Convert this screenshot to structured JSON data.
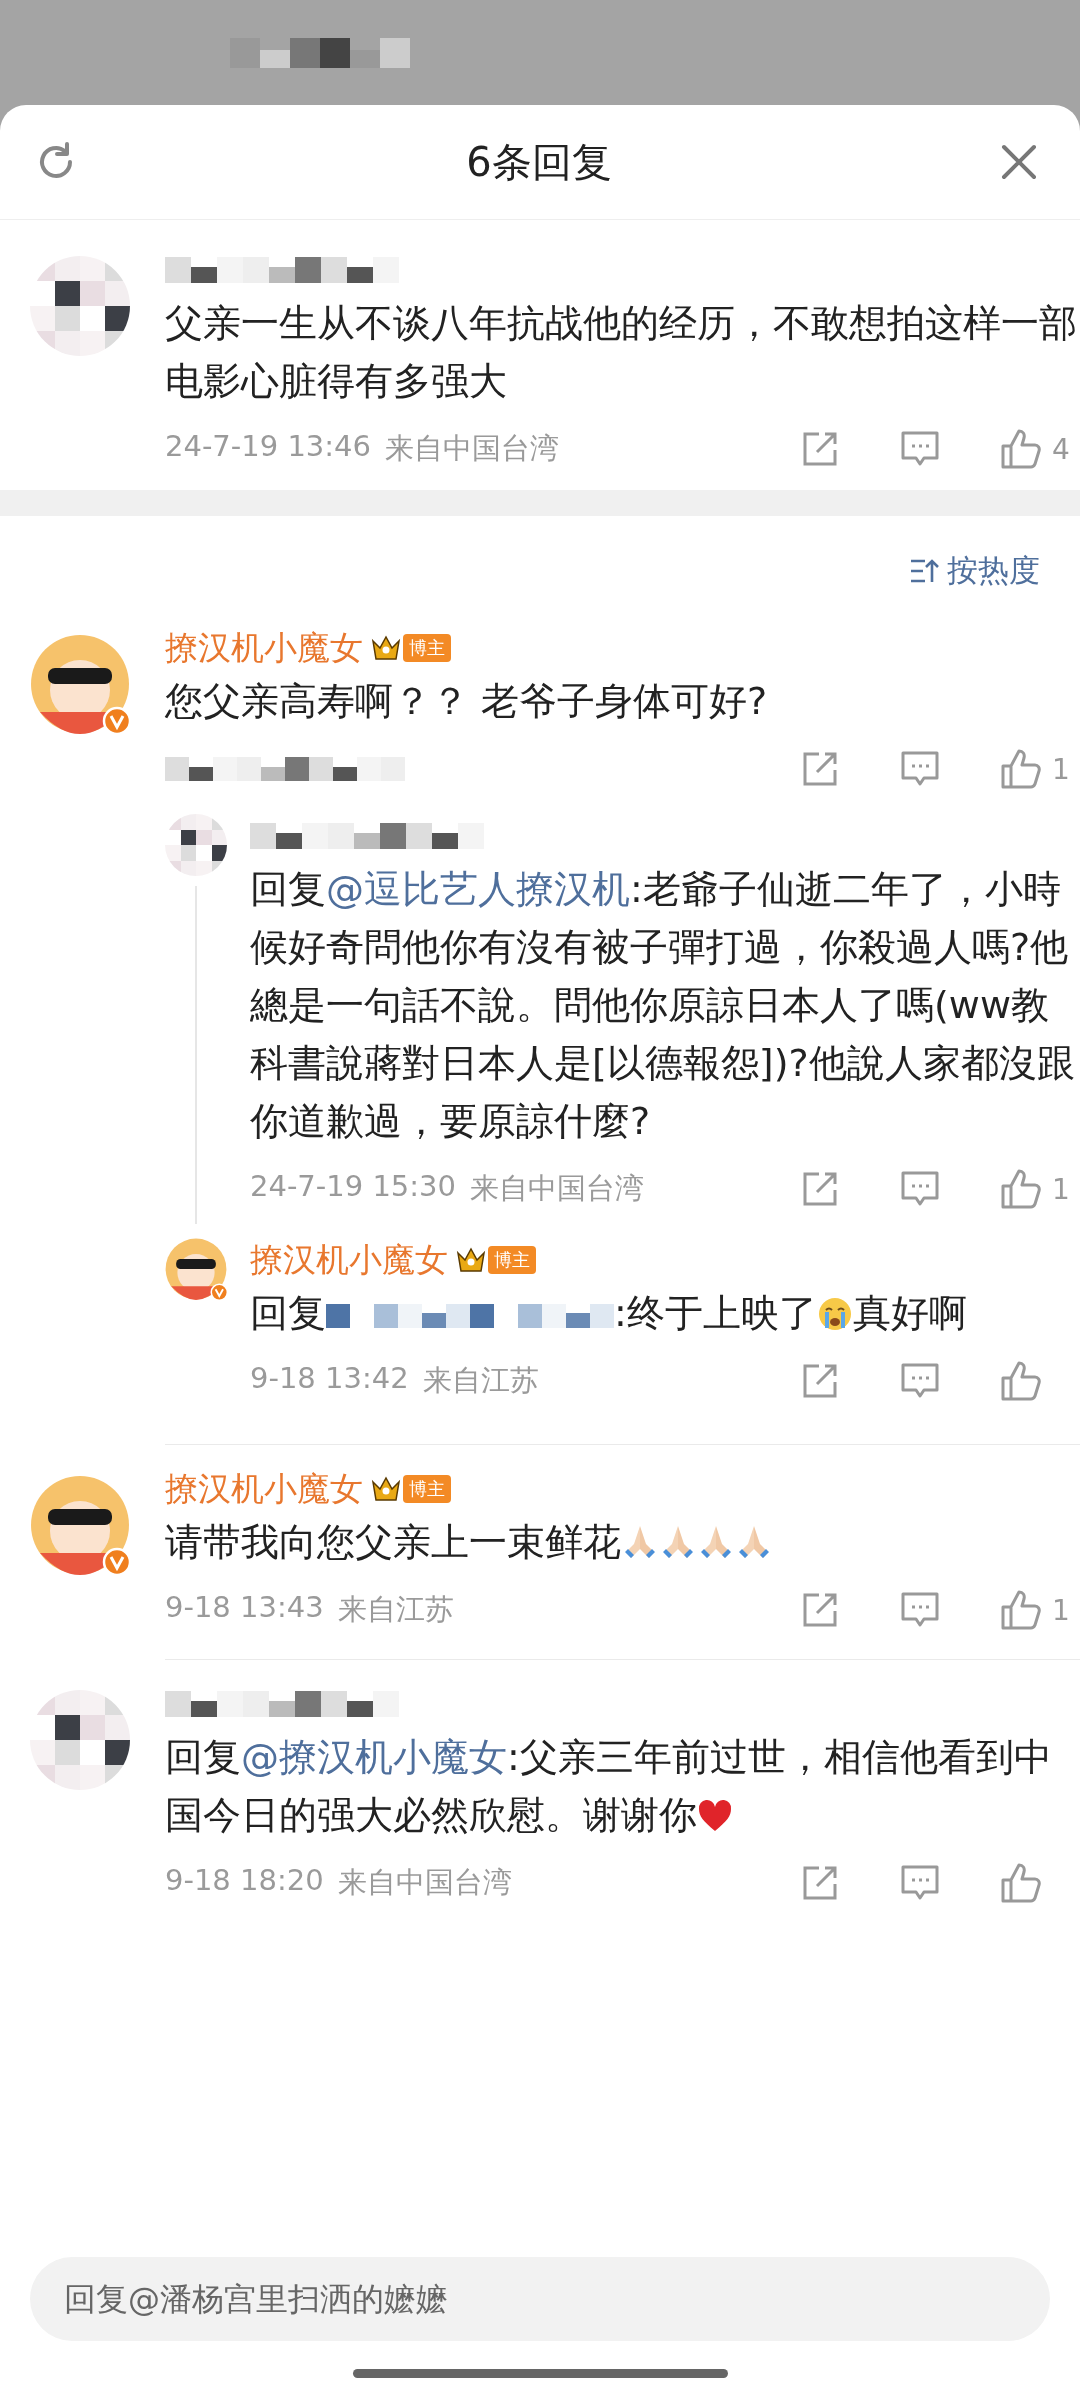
{
  "header": {
    "title": "6条回复"
  },
  "root_comment": {
    "author": {
      "kind": "pixelated"
    },
    "avatar": {
      "kind": "pixelated"
    },
    "content": [
      {
        "kind": "text",
        "text": "父亲一生从不谈八年抗战他的经历，不敢想拍这样一部电影心脏得有多强大"
      }
    ],
    "meta": {
      "kind": "plain",
      "time": "24-7-19 13:46",
      "location": "来自中国台湾"
    },
    "likes": "4"
  },
  "sort": {
    "label": "按热度"
  },
  "replies": [
    {
      "author": {
        "kind": "named",
        "name": "撩汉机小魔女",
        "badge": "博主"
      },
      "avatar": {
        "kind": "cartoon",
        "verified": true
      },
      "content": [
        {
          "kind": "text",
          "text": "您父亲高寿啊？？ 老爷子身体可好?"
        }
      ],
      "meta": {
        "kind": "pixelated"
      },
      "likes": "1",
      "children": [
        {
          "author": {
            "kind": "pixelated"
          },
          "avatar": {
            "kind": "pixelated"
          },
          "content": [
            {
              "kind": "text",
              "text": "回复"
            },
            {
              "kind": "mention",
              "text": "@逗比艺人撩汉机"
            },
            {
              "kind": "text",
              "text": ":老爺子仙逝二年了，小時候好奇問他你有沒有被子彈打過，你殺過人嗎?他總是一句話不說。問他你原諒日本人了嗎(ww教科書說蔣對日本人是[以德報怨])?他說人家都沒跟你道歉過，要原諒什麼?"
            }
          ],
          "meta": {
            "kind": "plain",
            "time": "24-7-19 15:30",
            "location": "来自中国台湾"
          },
          "likes": "1"
        },
        {
          "author": {
            "kind": "named",
            "name": "撩汉机小魔女",
            "badge": "博主"
          },
          "avatar": {
            "kind": "cartoon",
            "verified": true
          },
          "content": [
            {
              "kind": "text",
              "text": "回复"
            },
            {
              "kind": "pixelated-mention"
            },
            {
              "kind": "text",
              "text": ":终于上映了"
            },
            {
              "kind": "crying"
            },
            {
              "kind": "text",
              "text": "真好啊"
            }
          ],
          "meta": {
            "kind": "plain",
            "time": "9-18 13:42",
            "location": "来自江苏"
          }
        }
      ]
    },
    {
      "author": {
        "kind": "named",
        "name": "撩汉机小魔女",
        "badge": "博主"
      },
      "avatar": {
        "kind": "cartoon",
        "verified": true
      },
      "content": [
        {
          "kind": "text",
          "text": "请带我向您父亲上一束鲜花"
        },
        {
          "kind": "pray"
        },
        {
          "kind": "pray"
        },
        {
          "kind": "pray"
        },
        {
          "kind": "pray"
        }
      ],
      "meta": {
        "kind": "plain",
        "time": "9-18 13:43",
        "location": "来自江苏"
      },
      "likes": "1"
    },
    {
      "author": {
        "kind": "pixelated"
      },
      "avatar": {
        "kind": "pixelated"
      },
      "content": [
        {
          "kind": "text",
          "text": "回复"
        },
        {
          "kind": "mention",
          "text": "@撩汉机小魔女"
        },
        {
          "kind": "text",
          "text": ":父亲三年前过世，相信他看到中国今日的强大必然欣慰。谢谢你"
        },
        {
          "kind": "heart"
        }
      ],
      "meta": {
        "kind": "plain",
        "time": "9-18 18:20",
        "location": "来自中国台湾"
      }
    }
  ],
  "reply_box": {
    "placeholder": "回复@潘杨宫里扫洒的嬷嬷"
  }
}
